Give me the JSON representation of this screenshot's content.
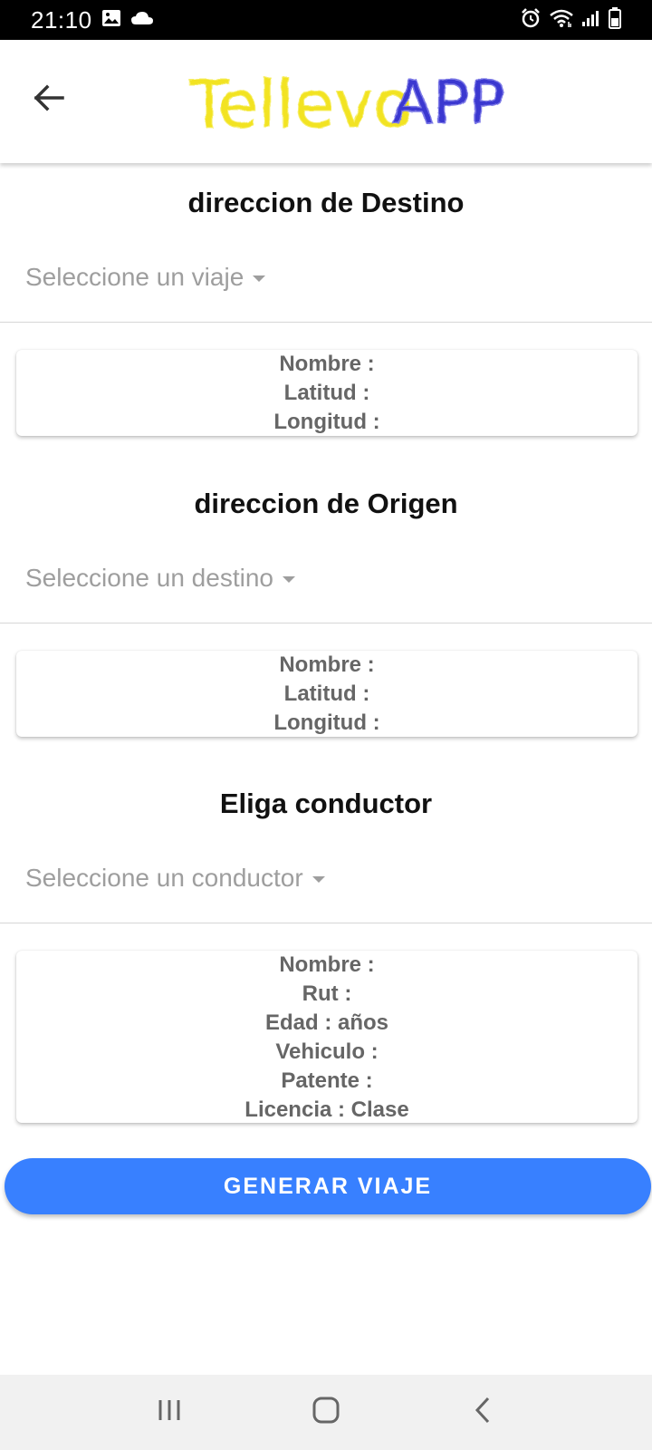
{
  "status_bar": {
    "time": "21:10",
    "icons": [
      "image-icon",
      "cloud-icon",
      "alarm-icon",
      "wifi-icon",
      "signal-icon",
      "battery-icon"
    ]
  },
  "header": {
    "logo_text_part1": "Tellevo",
    "logo_text_part2": "APP",
    "back_icon": "arrow-left-icon"
  },
  "destino": {
    "title": "direccion de Destino",
    "select_placeholder": "Seleccione un viaje",
    "card": [
      "Nombre :",
      "Latitud :",
      "Longitud :"
    ]
  },
  "origen": {
    "title": "direccion de Origen",
    "select_placeholder": "Seleccione un destino",
    "card": [
      "Nombre :",
      "Latitud :",
      "Longitud :"
    ]
  },
  "conductor": {
    "title": "Eliga conductor",
    "select_placeholder": "Seleccione un conductor",
    "card": [
      "Nombre :",
      "Rut :",
      "Edad : años",
      "Vehiculo :",
      "Patente :",
      "Licencia : Clase"
    ]
  },
  "generate_button": "GENERAR VIAJE",
  "nav_bar": {
    "icons": [
      "recent-apps-icon",
      "home-icon",
      "back-icon"
    ]
  },
  "colors": {
    "accent": "#3880ff",
    "logo_yellow": "#f2e320",
    "logo_blue": "#3a37d0"
  }
}
